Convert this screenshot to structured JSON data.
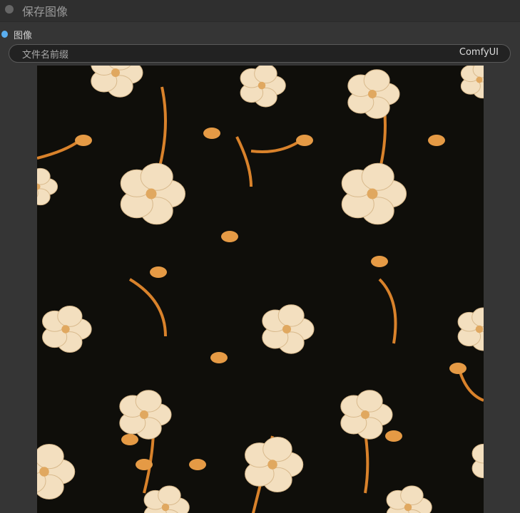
{
  "node": {
    "title": "保存图像",
    "input_slot": {
      "label": "图像",
      "color": "#5aaef0"
    },
    "widget": {
      "label": "文件名前缀",
      "value": "ComfyUI"
    },
    "preview": {
      "alt": "floral pattern image output"
    }
  }
}
